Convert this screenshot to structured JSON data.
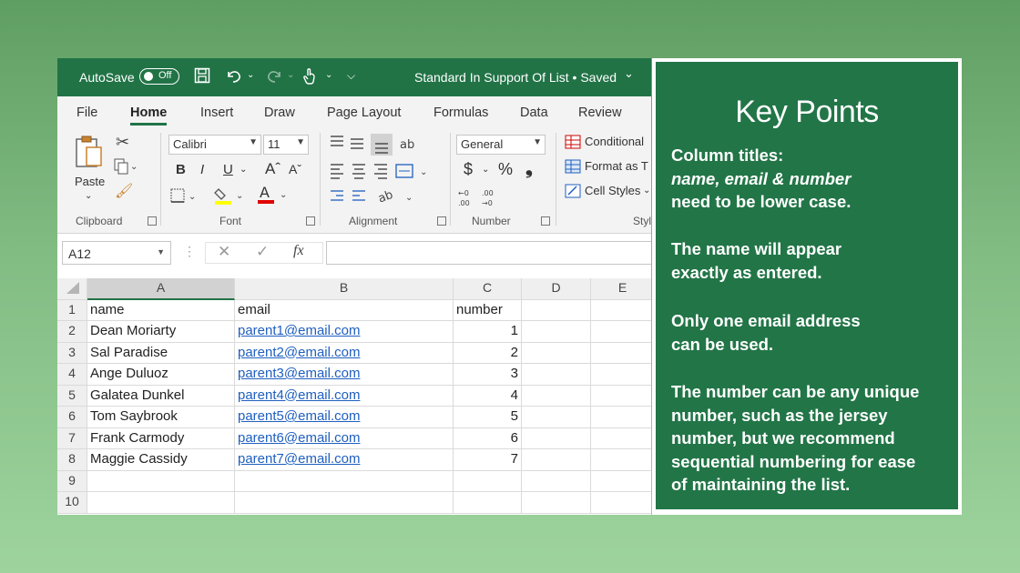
{
  "excel": {
    "titlebar": {
      "autosave_label": "AutoSave",
      "toggle_state": "Off",
      "doc_title": "Standard In Support Of List • Saved",
      "title_chevron": "⌄"
    },
    "menu": [
      "File",
      "Home",
      "Insert",
      "Draw",
      "Page Layout",
      "Formulas",
      "Data",
      "Review"
    ],
    "ribbon": {
      "clipboard": {
        "paste": "Paste",
        "label": "Clipboard"
      },
      "font": {
        "name": "Calibri",
        "size": "11",
        "bold": "B",
        "italic": "I",
        "underline": "U",
        "label": "Font"
      },
      "alignment": {
        "label": "Alignment"
      },
      "number": {
        "format": "General",
        "currency": "$",
        "percent": "%",
        "comma": "❟",
        "label": "Number"
      },
      "styles": {
        "conditional": "Conditional",
        "format_as": "Format as T",
        "cell_styles": "Cell Styles",
        "label": "Styl"
      }
    },
    "formula_bar": {
      "name_box": "A12",
      "fx": "fx",
      "value": ""
    },
    "columns": [
      "A",
      "B",
      "C",
      "D",
      "E"
    ],
    "rows": [
      {
        "n": "1",
        "a": "name",
        "b": "email",
        "c": "number",
        "link": false,
        "header": true
      },
      {
        "n": "2",
        "a": "Dean Moriarty",
        "b": "parent1@email.com",
        "c": "1",
        "link": true
      },
      {
        "n": "3",
        "a": "Sal Paradise",
        "b": "parent2@email.com",
        "c": "2",
        "link": true
      },
      {
        "n": "4",
        "a": "Ange Duluoz",
        "b": "parent3@email.com",
        "c": "3",
        "link": true
      },
      {
        "n": "5",
        "a": "Galatea Dunkel",
        "b": "parent4@email.com",
        "c": "4",
        "link": true
      },
      {
        "n": "6",
        "a": "Tom Saybrook",
        "b": "parent5@email.com",
        "c": "5",
        "link": true
      },
      {
        "n": "7",
        "a": "Frank Carmody",
        "b": "parent6@email.com",
        "c": "6",
        "link": true
      },
      {
        "n": "8",
        "a": "Maggie Cassidy",
        "b": "parent7@email.com",
        "c": "7",
        "link": true
      },
      {
        "n": "9",
        "a": "",
        "b": "",
        "c": "",
        "link": false
      },
      {
        "n": "10",
        "a": "",
        "b": "",
        "c": "",
        "link": false
      }
    ]
  },
  "key_points": {
    "title": "Key Points",
    "p1_line1": "Column titles:",
    "p1_line2": "name, email & number",
    "p1_line3": "need to be lower case.",
    "p2_line1": "The name will appear",
    "p2_line2": "exactly as entered.",
    "p3_line1": "Only one email address",
    "p3_line2": "can be used.",
    "p4_line1": "The number can be any unique",
    "p4_line2": "number, such as the jersey",
    "p4_line3": "number, but we recommend",
    "p4_line4": "sequential numbering for ease",
    "p4_line5": "of maintaining the list."
  },
  "colors": {
    "excel_green": "#217346",
    "panel_green": "#227547",
    "link_blue": "#1f5fbf"
  }
}
